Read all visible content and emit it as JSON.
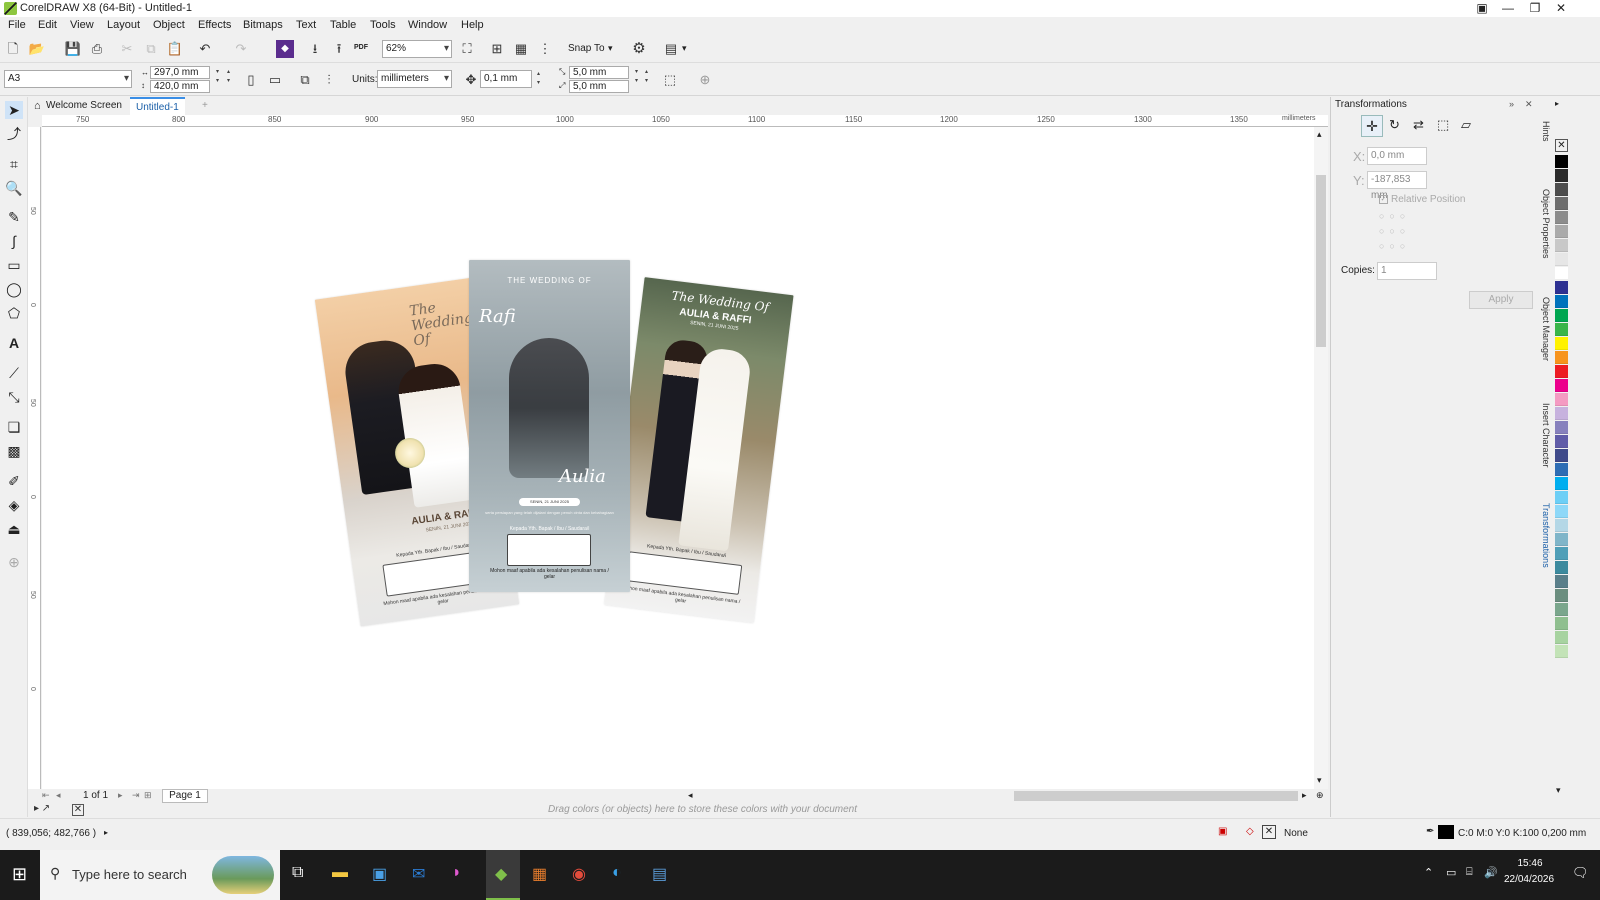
{
  "window": {
    "title": "CorelDRAW X8 (64-Bit) - Untitled-1"
  },
  "menu": [
    "File",
    "Edit",
    "View",
    "Layout",
    "Object",
    "Effects",
    "Bitmaps",
    "Text",
    "Table",
    "Tools",
    "Window",
    "Help"
  ],
  "toolbar": {
    "zoom": "62%",
    "snap_label": "Snap To",
    "pdf_label": "PDF",
    "page_size": "A3",
    "width": "297,0 mm",
    "height": "420,0 mm",
    "units_label": "Units:",
    "units_value": "millimeters",
    "nudge": "0,1 mm",
    "dup_x": "5,0 mm",
    "dup_y": "5,0 mm"
  },
  "tabs": {
    "welcome": "Welcome Screen",
    "doc": "Untitled-1"
  },
  "ruler": {
    "h_ticks": [
      "750",
      "800",
      "850",
      "900",
      "950",
      "1000",
      "1050",
      "1100",
      "1150",
      "1200",
      "1250",
      "1300",
      "1350"
    ],
    "unit": "millimeters",
    "v_ticks": [
      "50",
      "0",
      "50",
      "0",
      "50",
      "0"
    ]
  },
  "design": {
    "left": {
      "script_title": "The Wedding Of",
      "names": "AULIA & RAFFI",
      "date": "SENIN, 21 JUNI 2025",
      "to": "Kepada Yth. Bapak / Ibu / Saudara/i",
      "note": "Mohon maaf apabila ada kesalahan penulisan nama / gelar"
    },
    "middle": {
      "top": "THE WEDDING OF",
      "groom": "Rafi",
      "bride": "Aulia",
      "date": "SENIN, 21 JUNI 2025",
      "line": "serta persiapan yang telah dijalani dengan penuh cinta dan kebahagiaan",
      "to": "Kepada Yth. Bapak / Ibu / Saudara/i",
      "note": "Mohon maaf apabila ada kesalahan penulisan nama / gelar"
    },
    "right": {
      "script_title": "The Wedding Of",
      "names": "AULIA & RAFFI",
      "date": "SENIN, 21 JUNI 2025",
      "to": "Kepada Yth. Bapak / Ibu / Saudara/i",
      "note": "Mohon maaf apabila ada kesalahan penulisan nama / gelar"
    }
  },
  "pagenav": {
    "count": "1 of 1",
    "page": "Page 1"
  },
  "colorwell": "Drag colors (or objects) here to store these colors with your document",
  "status": {
    "coords": "( 839,056; 482,766 )",
    "fill": "None",
    "outline": "C:0 M:0 Y:0 K:100  0,200 mm"
  },
  "docker": {
    "title": "Transformations",
    "x_label": "X:",
    "x_value": "0,0 mm",
    "y_label": "Y:",
    "y_value": "-187,853 mm",
    "relative": "Relative Position",
    "copies_label": "Copies:",
    "copies_value": "1",
    "apply": "Apply"
  },
  "docker_tabs": [
    "Hints",
    "Object Properties",
    "Object Manager",
    "Insert Character",
    "Transformations"
  ],
  "palette": [
    "#000000",
    "#2b2b2b",
    "#4d4d4d",
    "#6e6e6e",
    "#8c8c8c",
    "#aaaaaa",
    "#c8c8c8",
    "#e6e6e6",
    "#ffffff",
    "#2e3192",
    "#0072bc",
    "#00a651",
    "#39b54a",
    "#fff200",
    "#f7941d",
    "#ed1c24",
    "#ec008c",
    "#f49ac2",
    "#c7b2de",
    "#8781bd",
    "#605ca8",
    "#3f4a8a",
    "#2e6db4",
    "#00aeef",
    "#6dcff6",
    "#8ed8f8",
    "#b4d7e6",
    "#7fb5c9",
    "#4f9fb8",
    "#3c8a9e",
    "#5a7f8a",
    "#6b8e7f",
    "#7aa68c",
    "#8fbf8f",
    "#a7d3a0",
    "#c3e3b7"
  ],
  "taskbar": {
    "search": "Type here to search",
    "time": "15:46",
    "date": "22/04/2026"
  }
}
